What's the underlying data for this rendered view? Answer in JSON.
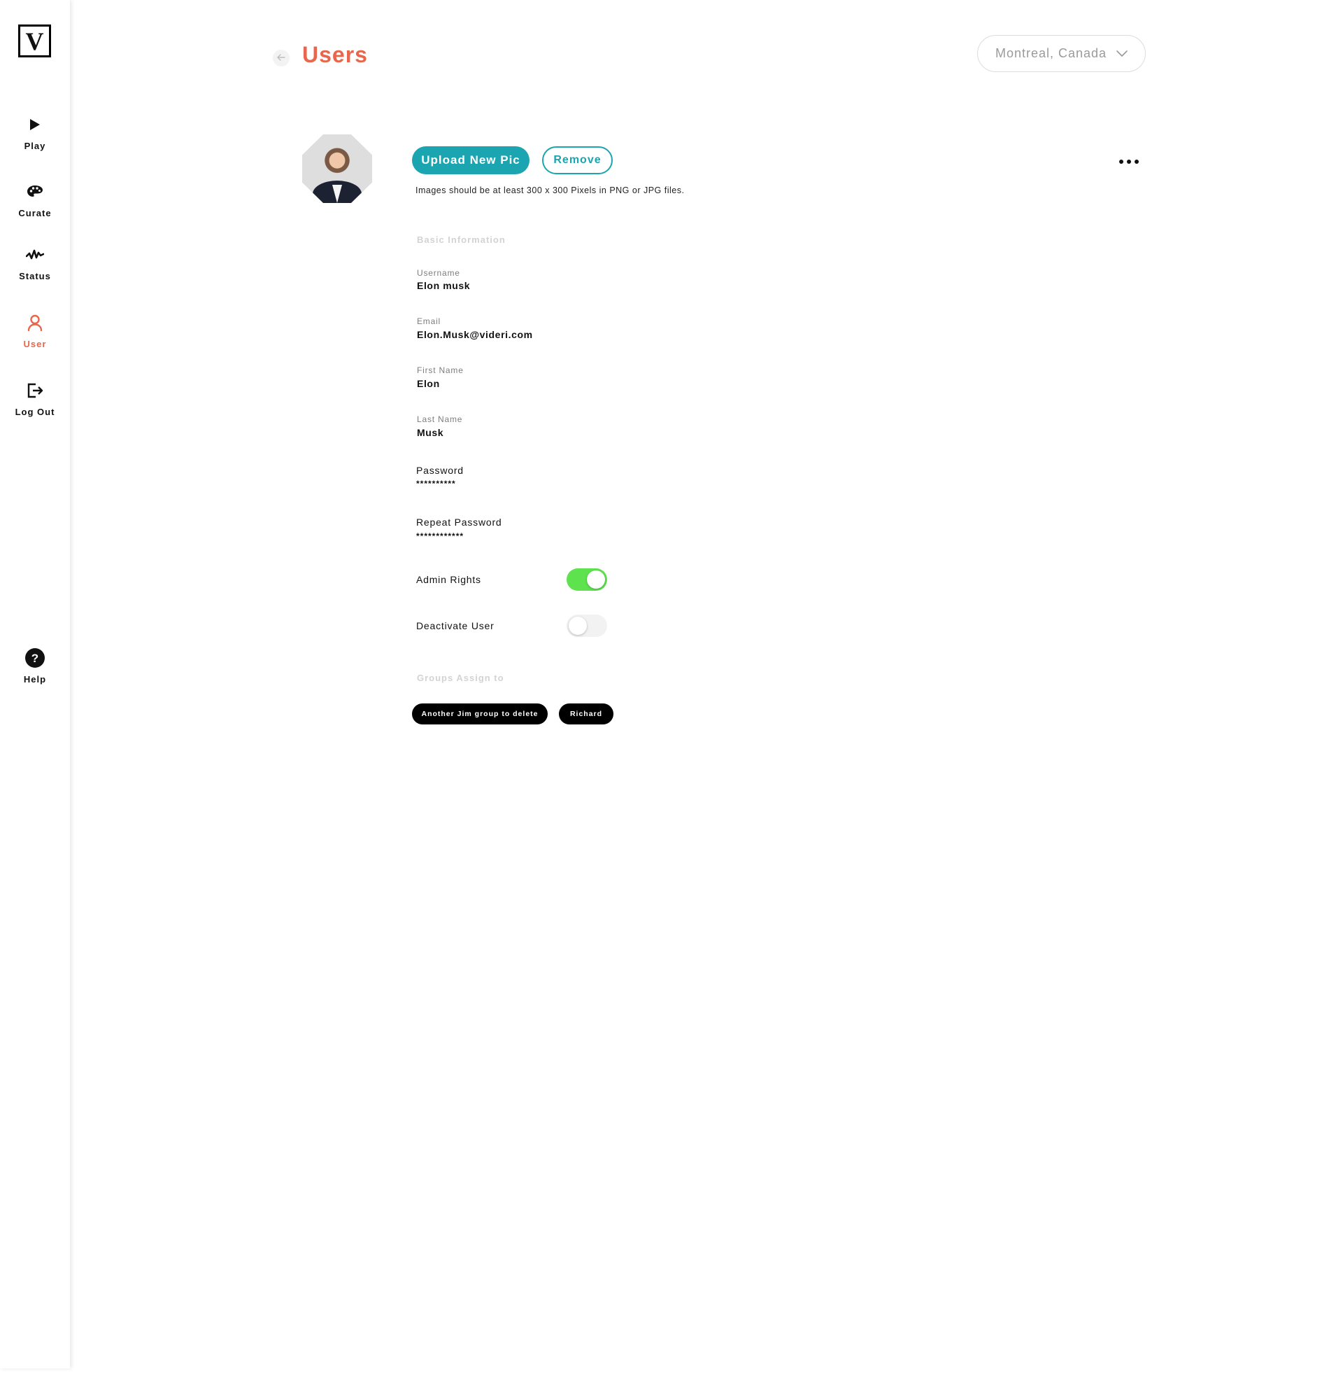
{
  "app": {
    "logo_letter": "V"
  },
  "sidebar": {
    "items": [
      {
        "label": "Play",
        "icon": "play-icon"
      },
      {
        "label": "Curate",
        "icon": "palette-icon"
      },
      {
        "label": "Status",
        "icon": "pulse-icon"
      },
      {
        "label": "User",
        "icon": "user-icon",
        "active": true
      },
      {
        "label": "Log Out",
        "icon": "logout-icon"
      }
    ],
    "help": {
      "label": "Help",
      "icon": "help-icon"
    }
  },
  "header": {
    "title": "Users",
    "location": "Montreal, Canada"
  },
  "profile_pic": {
    "upload_label": "Upload New Pic",
    "remove_label": "Remove",
    "hint": "Images should be at least 300 x 300 Pixels in PNG or JPG files."
  },
  "basic_info": {
    "heading": "Basic Information",
    "username": {
      "label": "Username",
      "value": "Elon musk"
    },
    "email": {
      "label": "Email",
      "value": "Elon.Musk@videri.com"
    },
    "first_name": {
      "label": "First Name",
      "value": "Elon"
    },
    "last_name": {
      "label": "Last Name",
      "value": "Musk"
    },
    "password": {
      "label": "Password",
      "value": "**********"
    },
    "repeat_password": {
      "label": "Repeat Password",
      "value": "************"
    }
  },
  "toggles": {
    "admin_rights": {
      "label": "Admin Rights",
      "on": true
    },
    "deactivate_user": {
      "label": "Deactivate User",
      "on": false
    }
  },
  "groups": {
    "heading": "Groups Assign to",
    "items": [
      "Another Jim group to delete",
      "Richard"
    ]
  },
  "colors": {
    "accent": "#e8674c",
    "primary": "#1aa5b0",
    "toggle_on": "#5ee34e"
  }
}
